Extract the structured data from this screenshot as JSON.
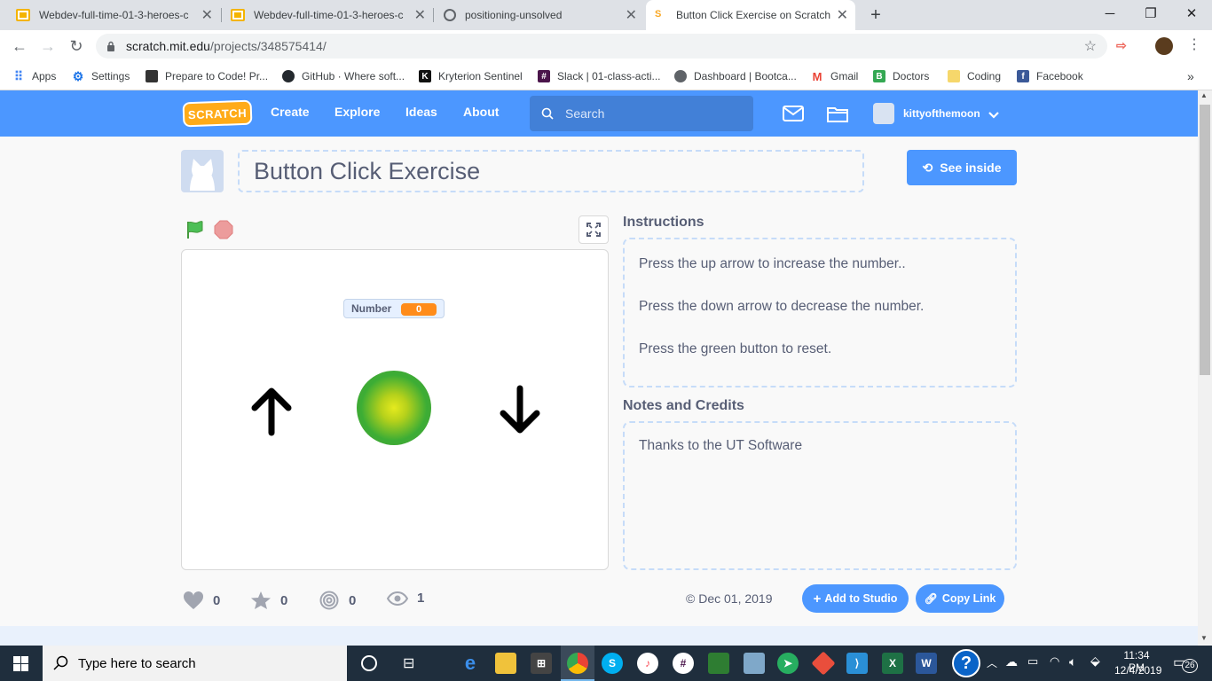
{
  "browser": {
    "tabs": [
      {
        "label": "Webdev-full-time-01-3-heroes-c",
        "icon_color": "#f4b400"
      },
      {
        "label": "Webdev-full-time-01-3-heroes-c",
        "icon_color": "#f4b400"
      },
      {
        "label": "positioning-unsolved",
        "icon_color": "#5f6368"
      },
      {
        "label": "Button Click Exercise on Scratch",
        "icon_color": "#f9a825"
      }
    ],
    "new_tab": "+",
    "url_host": "scratch.mit.edu",
    "url_path": "/projects/348575414/",
    "bookmarks": [
      {
        "label": "Apps",
        "icon_color": "#4285f4"
      },
      {
        "label": "Settings",
        "icon_color": "#1a73e8"
      },
      {
        "label": "Prepare to Code! Pr...",
        "icon_color": "#333333"
      },
      {
        "label": "GitHub · Where soft...",
        "icon_color": "#24292e"
      },
      {
        "label": "Kryterion Sentinel",
        "icon_color": "#111111"
      },
      {
        "label": "Slack | 01-class-acti...",
        "icon_color": "#4a154b"
      },
      {
        "label": "Dashboard | Bootca...",
        "icon_color": "#5f6368"
      },
      {
        "label": "Gmail",
        "icon_color": "#ea4335"
      },
      {
        "label": "Doctors",
        "icon_color": "#34a853"
      },
      {
        "label": "Coding",
        "icon_color": "#f6d76b"
      },
      {
        "label": "Facebook",
        "icon_color": "#3b5998"
      }
    ],
    "bookmarks_more": "»"
  },
  "scratch_nav": {
    "logo": "SCRATCH",
    "links": [
      "Create",
      "Explore",
      "Ideas",
      "About"
    ],
    "search_placeholder": "Search",
    "username": "kittyofthemoon"
  },
  "project": {
    "title": "Button Click Exercise",
    "see_inside": "See inside",
    "variable_label": "Number",
    "variable_value": "0",
    "instructions_heading": "Instructions",
    "instructions": [
      "Press the up arrow to increase the number..",
      "Press the down arrow to decrease the number.",
      "Press the green button to reset."
    ],
    "notes_heading": "Notes and Credits",
    "notes": "Thanks to the UT Software",
    "stats": {
      "loves": "0",
      "favorites": "0",
      "remixes": "0",
      "views": "1"
    },
    "date": "© Dec 01, 2019",
    "add_to_studio": "Add to Studio",
    "copy_link": "Copy Link"
  },
  "taskbar": {
    "search_placeholder": "Type here to search",
    "time": "11:34 PM",
    "date": "12/4/2019",
    "notification_count": "26"
  },
  "colors": {
    "scratch_blue": "#4c97ff",
    "variable_orange": "#ff8c1a",
    "flag_green": "#4cbf56",
    "stop_red": "#ec9c9c"
  }
}
